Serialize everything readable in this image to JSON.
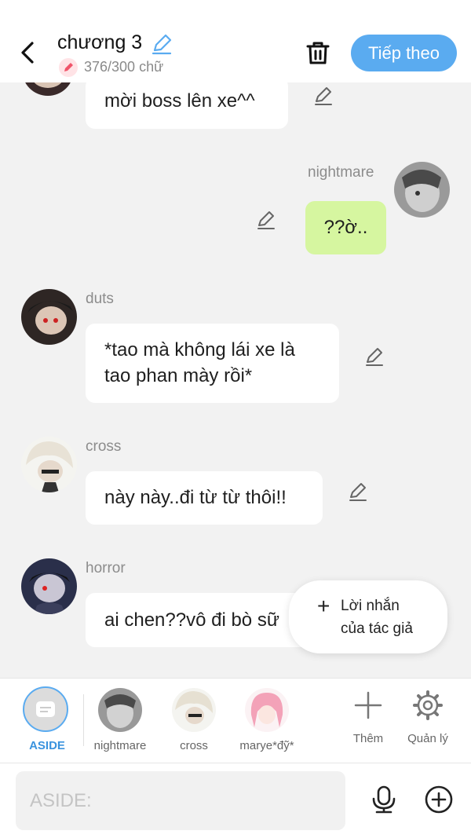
{
  "header": {
    "back_icon": "back-arrow-icon",
    "title": "chương 3",
    "title_edit_icon": "pencil-icon",
    "word_count": "376/300 chữ",
    "trash_icon": "trash-icon",
    "next_label": "Tiếp theo",
    "accent": "#5aabf0"
  },
  "messages": [
    {
      "side": "left",
      "name": "",
      "text": "mời boss lên xe^^"
    },
    {
      "side": "right",
      "name": "nightmare",
      "text": "??ờ.."
    },
    {
      "side": "left",
      "name": "duts",
      "text_line1": "*tao mà không lái xe là",
      "text_line2": "tao phan mày rồi*"
    },
    {
      "side": "left",
      "name": "cross",
      "text": "này này..đi từ từ thôi!!"
    },
    {
      "side": "left",
      "name": "horror",
      "text": "ai chen??vô đi bò sữ"
    }
  ],
  "author_note": {
    "line1": "Lời nhắn",
    "line2": "của tác giả"
  },
  "charbar": {
    "aside_label": "ASIDE",
    "characters": [
      "nightmare",
      "cross",
      "marye*đỹ*"
    ],
    "more_label": "Thêm",
    "manage_label": "Quản lý"
  },
  "input": {
    "placeholder": "ASIDE:"
  },
  "colors": {
    "bubble_right": "#d6f6a0",
    "background": "#f2f2f2"
  }
}
